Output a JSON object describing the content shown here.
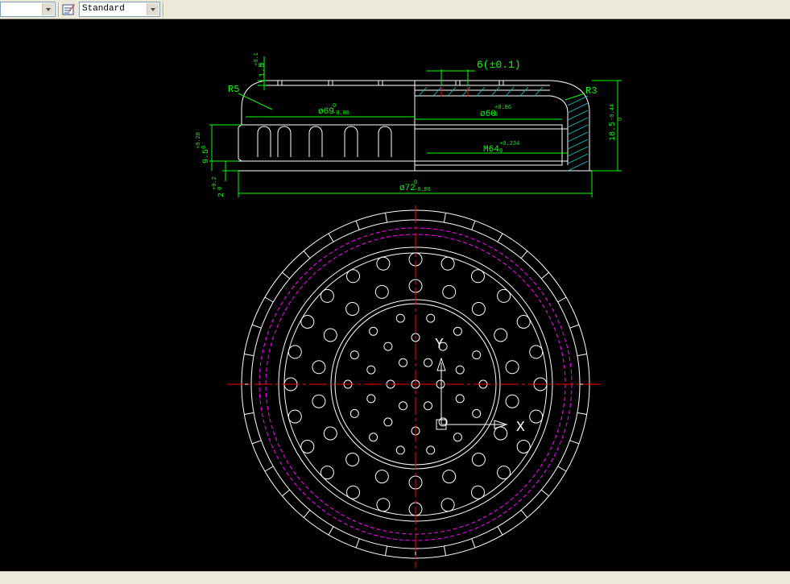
{
  "toolbar": {
    "layer_combo_value": "",
    "style_icon": "text-style-icon",
    "text_style_combo_value": "Standard",
    "dropdown_icon": "chevron-down-icon"
  },
  "drawing": {
    "dim_slot_width": "6(±0.1)",
    "dim_radius_left": "R5",
    "dim_radius_right": "R3",
    "dim_inner_diameter": "ø69",
    "dim_inner_diameter_tol_upper": "0",
    "dim_inner_diameter_tol_lower": "-0.86",
    "dim_bore": "ø60",
    "dim_bore_tol_upper": "+0.86",
    "dim_bore_tol_lower": "0",
    "dim_thread": "M64",
    "dim_thread_tol_upper": "+0.234",
    "dim_thread_tol_lower": "0",
    "dim_outer_diameter": "ø72",
    "dim_outer_diameter_tol_upper": "0",
    "dim_outer_diameter_tol_lower": "-0.86",
    "dim_top_thickness": "1.5",
    "dim_top_thickness_tol_upper": "+0.1",
    "dim_top_thickness_tol_lower": "0",
    "dim_wall_height": "9.5",
    "dim_wall_height_tol_upper": "+0.28",
    "dim_wall_height_tol_lower": "0",
    "dim_base": "2",
    "dim_base_tol_upper": "+0.2",
    "dim_base_tol_lower": "0",
    "dim_total_height": "18.5",
    "dim_total_height_tol_upper": "0",
    "dim_total_height_tol_lower": "-0.44",
    "ucs_x_label": "X",
    "ucs_y_label": "Y",
    "colors": {
      "background": "#000000",
      "geometry": "#ffffff",
      "dimension": "#00ff00",
      "centerline": "#ff0000",
      "hidden": "#ff00ff",
      "hatch": "#00cccc"
    }
  }
}
